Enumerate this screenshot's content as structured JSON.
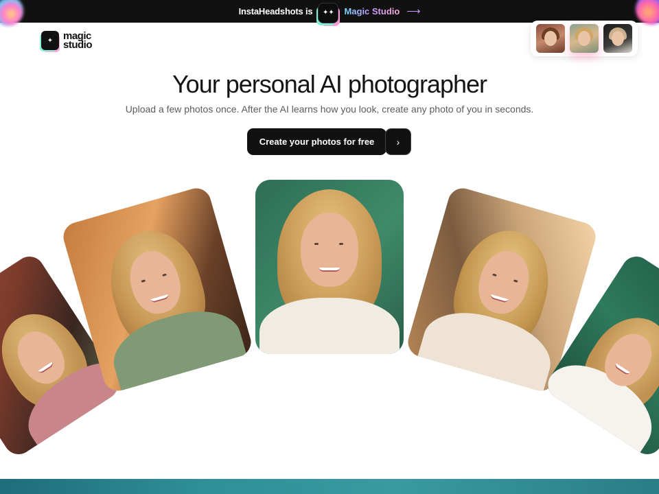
{
  "banner": {
    "text": "InstaHeadshots is",
    "link_label": "Magic Studio",
    "arrow": "⟶",
    "logo_icon": "sparkle-logo-icon"
  },
  "header": {
    "logo_line1": "magic",
    "logo_line2": "studio",
    "avatars": [
      "avatar-1",
      "avatar-2",
      "avatar-3"
    ]
  },
  "hero": {
    "title": "Your personal AI photographer",
    "subtitle": "Upload a few photos once. After the AI learns how you look, create any photo of you in seconds.",
    "cta_label": "Create your photos for free",
    "cta_arrow": "›"
  },
  "gallery": {
    "photos": [
      "far-left-portrait",
      "left-portrait",
      "center-portrait",
      "right-portrait",
      "far-right-portrait"
    ]
  },
  "colors": {
    "banner_bg": "#111111",
    "cta_bg": "#111111",
    "accent_gradient_start": "#7ad7ff",
    "accent_gradient_end": "#ffb0d9"
  }
}
